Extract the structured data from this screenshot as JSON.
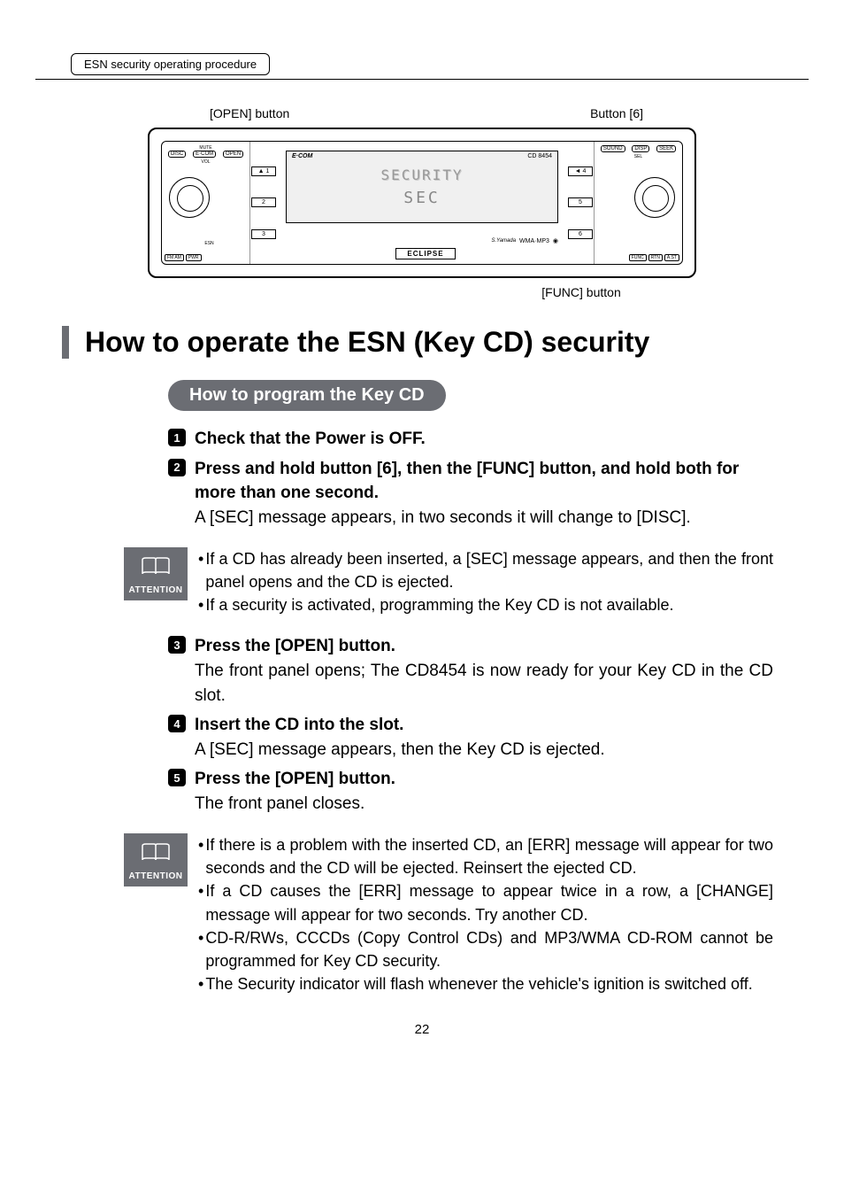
{
  "header": {
    "tab": "ESN security operating procedure"
  },
  "diagram": {
    "label_open": "[OPEN] button",
    "label_button6": "Button [6]",
    "label_func": "[FUNC] button",
    "top_left_btns": [
      "DISC",
      "E·COM",
      "OPEN"
    ],
    "top_right_btns": [
      "SOUND",
      "DISP",
      "SEEK"
    ],
    "bottom_left_btns": [
      "FM AM",
      "PWR"
    ],
    "bottom_right_btns": [
      "FUNC",
      "RTN",
      "A.ST"
    ],
    "left_side_btns": [
      "▲ 1",
      "2",
      "3"
    ],
    "right_side_btns": [
      "◄ 4",
      "5",
      "6"
    ],
    "screen_brand": "E·COM",
    "screen_model": "CD 8454",
    "screen_text1": "SECURITY",
    "screen_text2": "SEC",
    "eclipse": "ECLIPSE",
    "mute": "MUTE",
    "vol": "VOL",
    "esn": "ESN",
    "sel": "SEL",
    "wma_mp3": "WMA·MP3",
    "signature": "S.Yamada"
  },
  "main_heading": "How to operate the ESN (Key CD) security",
  "sub_heading": "How to program the Key CD",
  "steps": {
    "s1": {
      "title": "Check that the Power is OFF."
    },
    "s2": {
      "title": "Press and hold button [6], then the [FUNC] button, and hold both for more than one second.",
      "body": "A [SEC] message appears, in two seconds it will change to [DISC]."
    },
    "s3": {
      "title": "Press the [OPEN] button.",
      "body": "The front panel opens; The CD8454 is now ready for your Key CD in the CD slot."
    },
    "s4": {
      "title": "Insert the CD into the slot.",
      "body": "A [SEC] message appears, then the Key CD is ejected."
    },
    "s5": {
      "title": "Press the [OPEN] button.",
      "body": "The front panel closes."
    }
  },
  "attention_label": "ATTENTION",
  "attention1": {
    "b1": "If a CD has already been inserted, a [SEC] message appears, and then the front panel opens and the CD is ejected.",
    "b2": "If a security is activated, programming the Key CD is not available."
  },
  "attention2": {
    "b1": "If there is a problem with the inserted CD, an [ERR] message will appear for two seconds and the CD will be ejected. Reinsert the ejected CD.",
    "b2": "If a CD causes the [ERR] message to appear twice in a row, a [CHANGE] message will appear for two seconds. Try another CD.",
    "b3": "CD-R/RWs, CCCDs (Copy Control CDs) and MP3/WMA CD-ROM cannot be programmed for Key CD security.",
    "b4": "The Security indicator will flash whenever the vehicle's ignition is switched off."
  },
  "page_number": "22"
}
